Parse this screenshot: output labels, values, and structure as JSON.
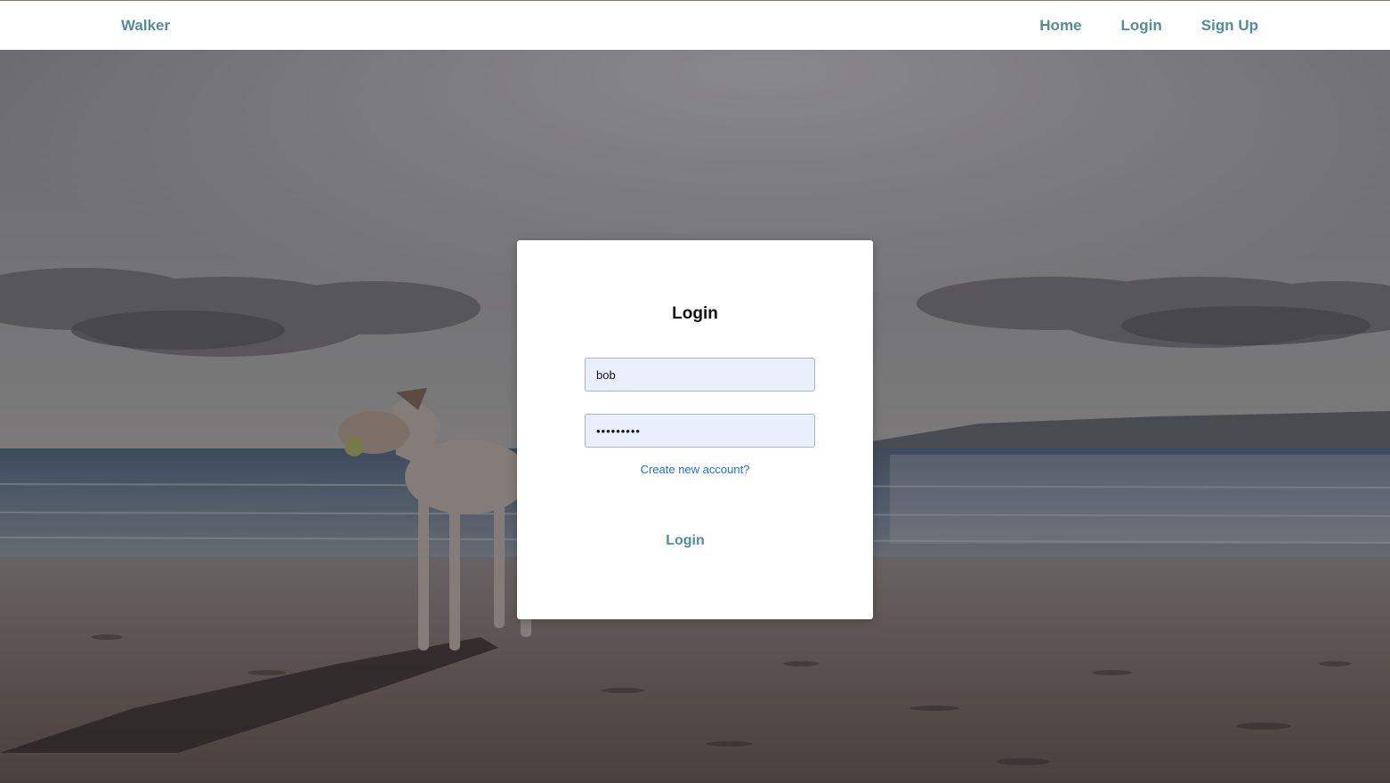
{
  "navbar": {
    "brand": "Walker",
    "links": [
      {
        "label": "Home"
      },
      {
        "label": "Login"
      },
      {
        "label": "Sign Up"
      }
    ]
  },
  "login_form": {
    "title": "Login",
    "username_value": "bob",
    "password_masked": "•••••••••",
    "create_account_link": "Create new account?",
    "submit_label": "Login"
  },
  "colors": {
    "accent": "#4f8f95",
    "link": "#1a73e8",
    "field_bg": "#e8f0fe"
  }
}
